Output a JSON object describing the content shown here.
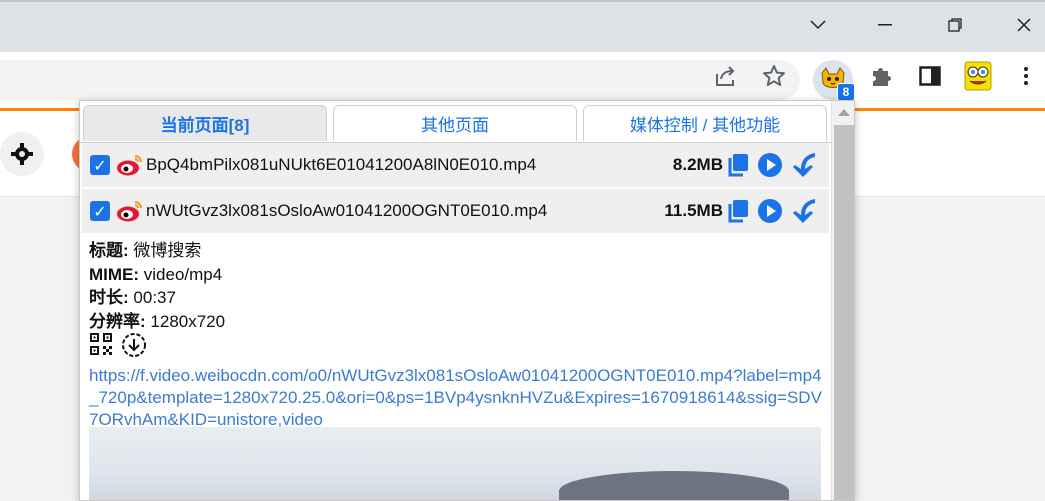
{
  "window": {
    "controls": [
      "chevron-down",
      "minimize",
      "restore",
      "close"
    ]
  },
  "popup": {
    "tabs": [
      {
        "label": "当前页面[8]",
        "active": true
      },
      {
        "label": "其他页面",
        "active": false
      },
      {
        "label": "媒体控制 / 其他功能",
        "active": false
      }
    ],
    "files": [
      {
        "name": "BpQ4bmPilx081uNUkt6E01041200A8lN0E010.mp4",
        "size": "8.2MB",
        "checked": true
      },
      {
        "name": "nWUtGvz3lx081sOsloAw01041200OGNT0E010.mp4",
        "size": "11.5MB",
        "checked": true
      }
    ],
    "details": {
      "title_label": "标题:",
      "title_value": "微博搜索",
      "mime_label": "MIME:",
      "mime_value": "video/mp4",
      "duration_label": "时长:",
      "duration_value": "00:37",
      "resolution_label": "分辨率:",
      "resolution_value": "1280x720",
      "url": "https://f.video.weibocdn.com/o0/nWUtGvz3lx081sOsloAw01041200OGNT0E010.mp4?label=mp4_720p&template=1280x720.25.0&ori=0&ps=1BVp4ysnknHVZu&Expires=1670918614&ssig=SDV7ORvhAm&KID=unistore,video"
    }
  },
  "extension": {
    "badge": "8"
  },
  "colors": {
    "accent": "#1a73e8",
    "weibo_red": "#e6162d",
    "orange": "#ff8200"
  }
}
